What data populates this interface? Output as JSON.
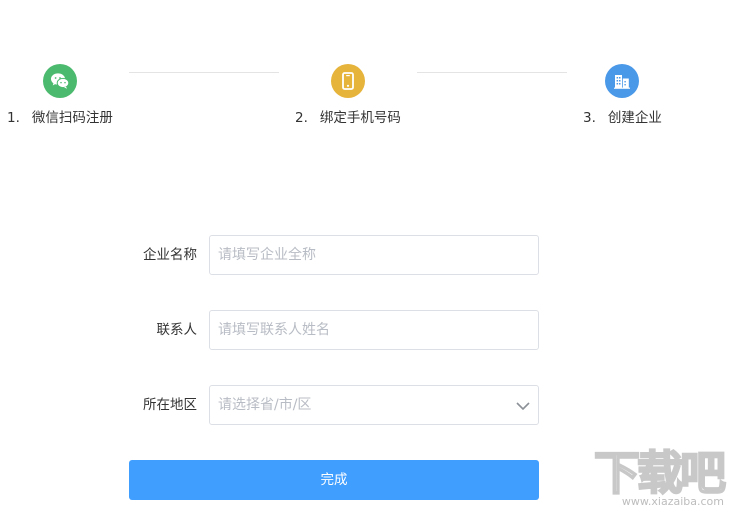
{
  "steps": [
    {
      "number": "1.",
      "label": "微信扫码注册",
      "icon": "wechat-icon",
      "color": "#4cba6e"
    },
    {
      "number": "2.",
      "label": "绑定手机号码",
      "icon": "mobile-phone-icon",
      "color": "#e7b43b"
    },
    {
      "number": "3.",
      "label": "创建企业",
      "icon": "building-icon",
      "color": "#4a98e8"
    }
  ],
  "form": {
    "company_name": {
      "label": "企业名称",
      "placeholder": "请填写企业全称"
    },
    "contact": {
      "label": "联系人",
      "placeholder": "请填写联系人姓名"
    },
    "region": {
      "label": "所在地区",
      "placeholder": "请选择省/市/区"
    },
    "submit_label": "完成"
  },
  "theme": {
    "primary": "#409eff",
    "border": "#dcdfe6",
    "placeholder": "#b8bcc4"
  },
  "watermark": {
    "logo_text": "下载吧",
    "url": "www.xiazaiba.com"
  }
}
